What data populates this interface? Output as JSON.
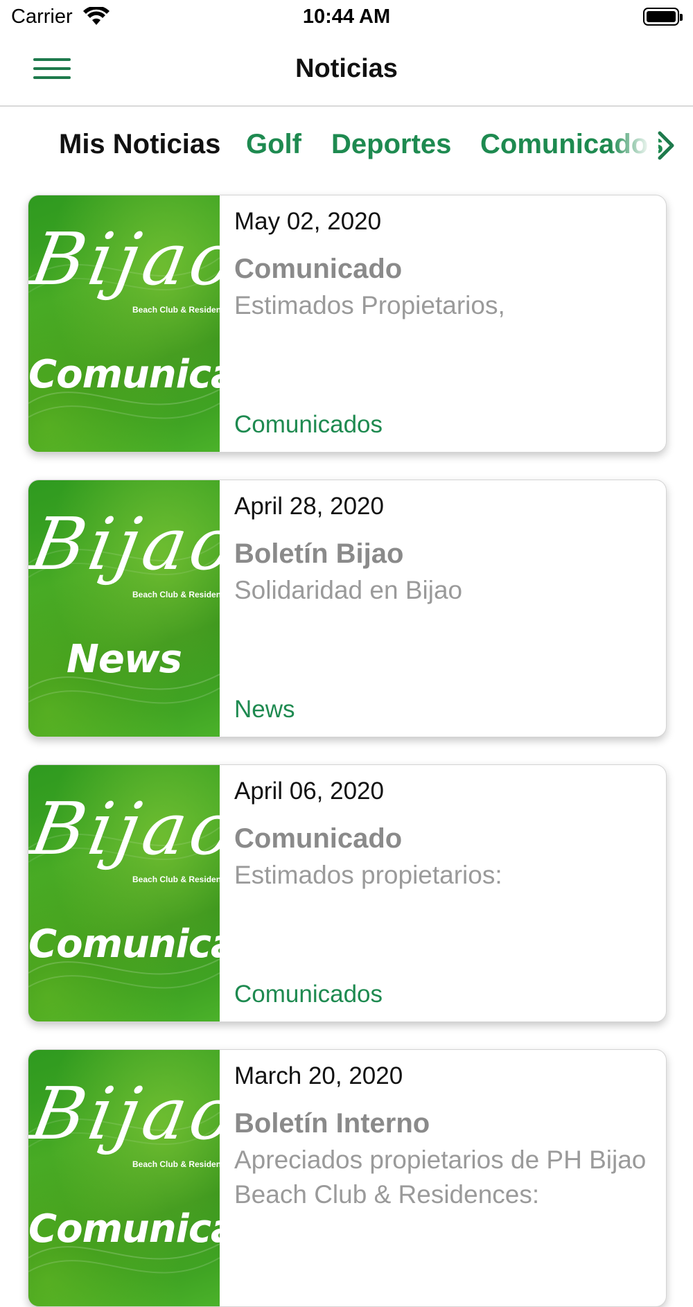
{
  "status_bar": {
    "carrier": "Carrier",
    "time": "10:44 AM",
    "wifi_icon": "wifi-icon",
    "battery_icon": "battery-icon"
  },
  "nav": {
    "title": "Noticias",
    "menu_icon": "hamburger-menu-icon"
  },
  "tabs": [
    {
      "label": "Mis Noticias",
      "active": true
    },
    {
      "label": "Golf",
      "active": false
    },
    {
      "label": "Deportes",
      "active": false
    },
    {
      "label": "Comunicados",
      "active": false
    }
  ],
  "tabs_more_icon": "chevron-right-icon",
  "colors": {
    "accent": "#1e8a50",
    "card_title": "#8a8a8a",
    "card_summary": "#9a9a9a",
    "thumb_green": "#3fa524"
  },
  "cards": [
    {
      "date": "May 02, 2020",
      "title": "Comunicado",
      "summary": "Estimados Propietarios,",
      "category": "Comunicados",
      "thumb_logo": "Bijao",
      "thumb_logo_sub": "Beach Club & Residences",
      "thumb_word": "Comunicados"
    },
    {
      "date": "April 28, 2020",
      "title": "Boletín Bijao",
      "summary": "Solidaridad en Bijao",
      "category": "News",
      "thumb_logo": "Bijao",
      "thumb_logo_sub": "Beach Club & Residences",
      "thumb_word": "News"
    },
    {
      "date": "April 06, 2020",
      "title": "Comunicado",
      "summary": "Estimados propietarios:",
      "category": "Comunicados",
      "thumb_logo": "Bijao",
      "thumb_logo_sub": "Beach Club & Residences",
      "thumb_word": "Comunicados"
    },
    {
      "date": "March 20, 2020",
      "title": "Boletín Interno",
      "summary": "Apreciados propietarios de PH Bijao Beach Club & Residences:",
      "category": "",
      "thumb_logo": "Bijao",
      "thumb_logo_sub": "Beach Club & Residences",
      "thumb_word": "Comunicados"
    }
  ]
}
